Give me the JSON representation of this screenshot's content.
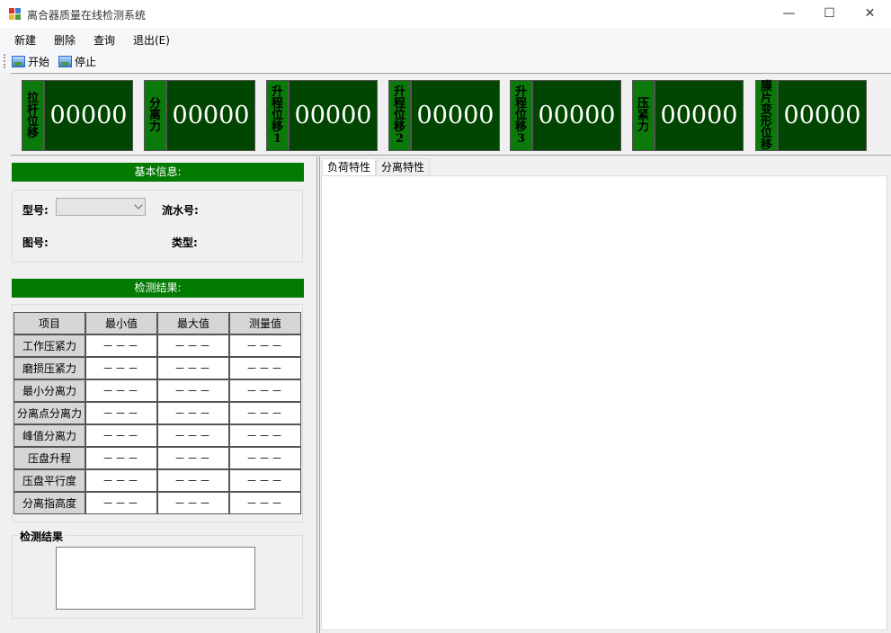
{
  "window": {
    "title": "离合器质量在线检测系统",
    "minimize": "—",
    "maximize": "☐",
    "close": "✕"
  },
  "menu": [
    "新建",
    "删除",
    "查询",
    "退出(E)"
  ],
  "toolbar": {
    "start_label": "开始",
    "stop_label": "停止"
  },
  "displays": [
    {
      "label": "拉杆位移",
      "value": "00000"
    },
    {
      "label": "分离力",
      "value": "00000"
    },
    {
      "label": "升程位移1",
      "value": "00000"
    },
    {
      "label": "升程位移2",
      "value": "00000"
    },
    {
      "label": "升程位移3",
      "value": "00000"
    },
    {
      "label": "压紧力",
      "value": "00000"
    },
    {
      "label": "膜片变形位移",
      "value": "00000"
    }
  ],
  "basic_info": {
    "header": "基本信息:",
    "model_label": "型号:",
    "model_value": "",
    "serial_label": "流水号:",
    "drawing_label": "图号:",
    "type_label": "类型:"
  },
  "results": {
    "header": "检测结果:",
    "columns": [
      "项目",
      "最小值",
      "最大值",
      "测量值"
    ],
    "rows": [
      {
        "item": "工作压紧力",
        "min": "－－－",
        "max": "－－－",
        "measured": "－－－"
      },
      {
        "item": "磨损压紧力",
        "min": "－－－",
        "max": "－－－",
        "measured": "－－－"
      },
      {
        "item": "最小分离力",
        "min": "－－－",
        "max": "－－－",
        "measured": "－－－"
      },
      {
        "item": "分离点分离力",
        "min": "－－－",
        "max": "－－－",
        "measured": "－－－"
      },
      {
        "item": "峰值分离力",
        "min": "－－－",
        "max": "－－－",
        "measured": "－－－"
      },
      {
        "item": "压盘升程",
        "min": "－－－",
        "max": "－－－",
        "measured": "－－－"
      },
      {
        "item": "压盘平行度",
        "min": "－－－",
        "max": "－－－",
        "measured": "－－－"
      },
      {
        "item": "分离指高度",
        "min": "－－－",
        "max": "－－－",
        "measured": "－－－"
      }
    ],
    "result_group_label": "检测结果",
    "result_text": ""
  },
  "tabs": [
    {
      "label": "负荷特性",
      "active": true
    },
    {
      "label": "分离特性",
      "active": false
    }
  ]
}
